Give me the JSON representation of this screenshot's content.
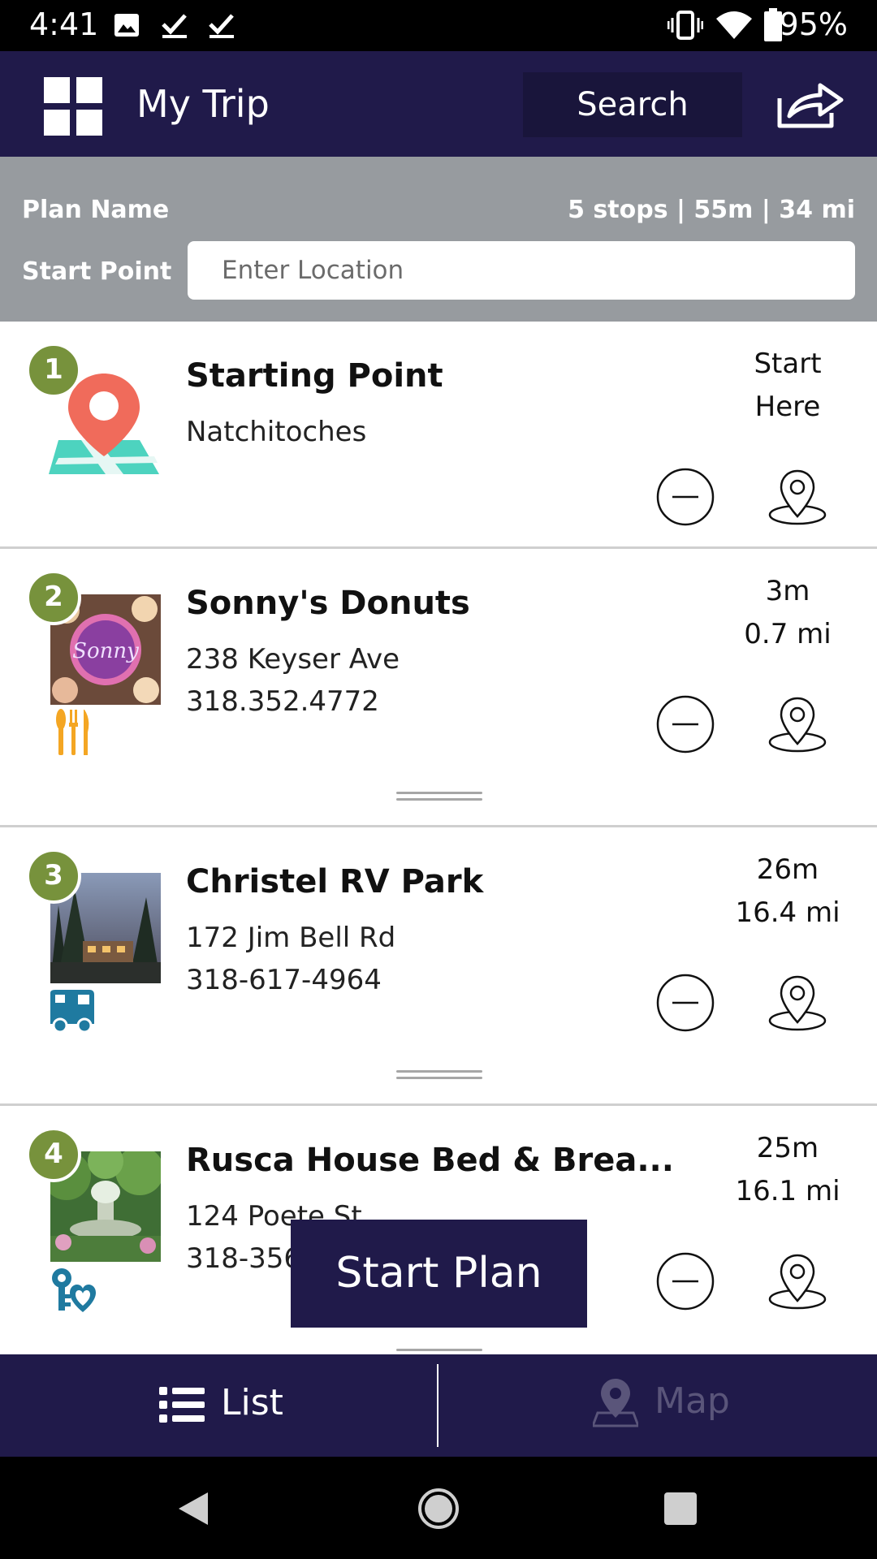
{
  "status_bar": {
    "time": "4:41",
    "battery": "95%"
  },
  "header": {
    "title": "My Trip",
    "search_label": "Search"
  },
  "plan": {
    "name_label": "Plan Name",
    "summary": "5 stops | 55m | 34 mi",
    "start_label": "Start Point",
    "start_placeholder": "Enter Location"
  },
  "stops": [
    {
      "number": "1",
      "name": "Starting Point",
      "line1": "Natchitoches",
      "line2": "",
      "meta1": "Start",
      "meta2": "Here",
      "category_icon": "map-pin-icon"
    },
    {
      "number": "2",
      "name": "Sonny's Donuts",
      "line1": "238 Keyser Ave",
      "line2": "318.352.4772",
      "meta1": "3m",
      "meta2": "0.7 mi",
      "category_icon": "fork-knife-icon"
    },
    {
      "number": "3",
      "name": "Christel RV Park",
      "line1": "172 Jim Bell Rd",
      "line2": "318-617-4964",
      "meta1": "26m",
      "meta2": "16.4 mi",
      "category_icon": "rv-icon"
    },
    {
      "number": "4",
      "name": "Rusca House Bed & Brea...",
      "line1": "124 Poete St",
      "line2": "318-356-5598",
      "meta1": "25m",
      "meta2": "16.1 mi",
      "category_icon": "key-heart-icon"
    }
  ],
  "start_plan_label": "Start Plan",
  "tabs": [
    {
      "label": "List",
      "active": true
    },
    {
      "label": "Map",
      "active": false
    }
  ],
  "colors": {
    "primary": "#201a4a",
    "badge_green": "#77923c",
    "plan_gray": "#979b9f"
  }
}
